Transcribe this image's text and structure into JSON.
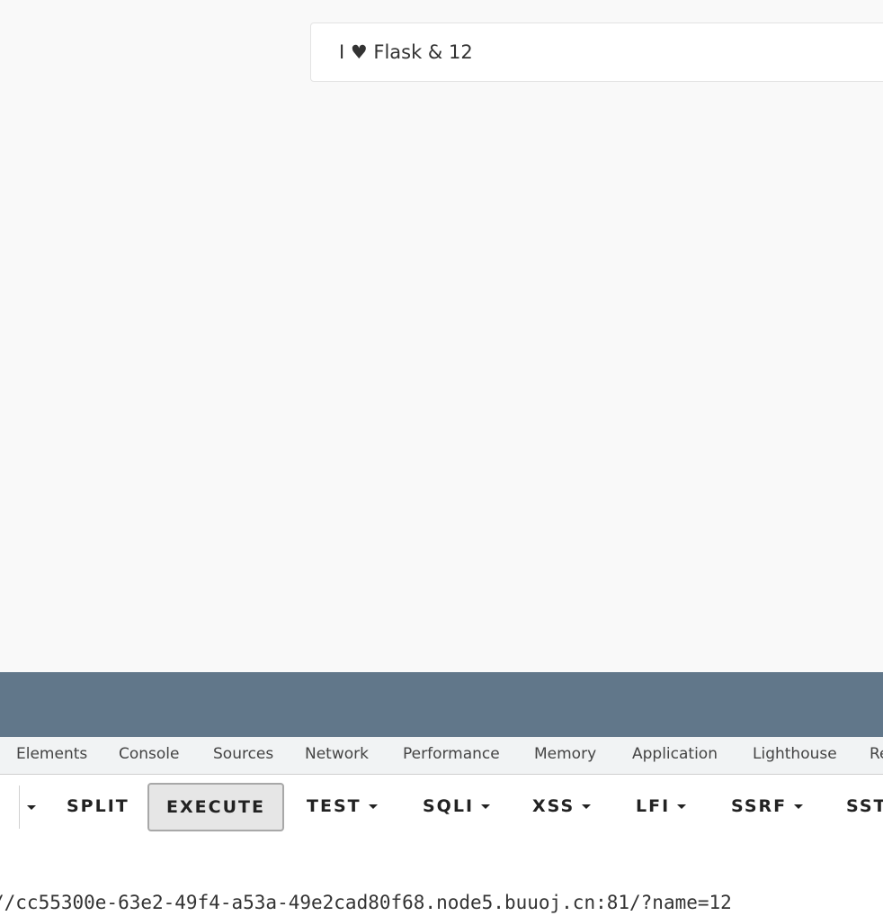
{
  "page": {
    "greeting": "I ♥ Flask & 12"
  },
  "devtools": {
    "tabs": [
      "Elements",
      "Console",
      "Sources",
      "Network",
      "Performance",
      "Memory",
      "Application",
      "Lighthouse",
      "Re"
    ]
  },
  "hackbar": {
    "buttons": {
      "split": "SPLIT",
      "execute": "EXECUTE",
      "test": "TEST",
      "sqli": "SQLI",
      "xss": "XSS",
      "lfi": "LFI",
      "ssrf": "SSRF",
      "ssti": "SST"
    },
    "url_value": "//cc55300e-63e2-49f4-a53a-49e2cad80f68.node5.buuoj.cn:81/?name=12"
  },
  "colors": {
    "page_bg": "#f9f9f9",
    "devtools_header": "#61778a",
    "execute_bg": "#e6e6e6"
  }
}
